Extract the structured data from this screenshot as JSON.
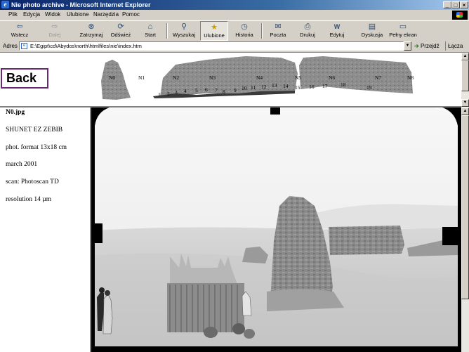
{
  "window": {
    "title": "Nie photo archive - Microsoft Internet Explorer",
    "controls": [
      "_",
      "□",
      "×"
    ]
  },
  "menu": [
    "Plik",
    "Edycja",
    "Widok",
    "Ulubione",
    "Narzędzia",
    "Pomoc"
  ],
  "toolbar": [
    {
      "label": "Wstecz",
      "icon": "back-arrow-icon",
      "glyph": "⇦",
      "enabled": true
    },
    {
      "label": "Dalej",
      "icon": "forward-arrow-icon",
      "glyph": "⇨",
      "enabled": false
    },
    {
      "label": "Zatrzymaj",
      "icon": "stop-icon",
      "glyph": "⊗",
      "enabled": true
    },
    {
      "label": "Odśwież",
      "icon": "refresh-icon",
      "glyph": "⟳",
      "enabled": true
    },
    {
      "label": "Start",
      "icon": "home-icon",
      "glyph": "⌂",
      "enabled": true
    },
    {
      "label": "Wyszukaj",
      "icon": "search-icon",
      "glyph": "⚲",
      "enabled": true
    },
    {
      "label": "Ulubione",
      "icon": "favorites-icon",
      "glyph": "★",
      "enabled": true
    },
    {
      "label": "Historia",
      "icon": "history-icon",
      "glyph": "◷",
      "enabled": true
    },
    {
      "label": "Poczta",
      "icon": "mail-icon",
      "glyph": "✉",
      "enabled": true
    },
    {
      "label": "Drukuj",
      "icon": "print-icon",
      "glyph": "⎙",
      "enabled": true
    },
    {
      "label": "Edytuj",
      "icon": "edit-icon",
      "glyph": "W",
      "enabled": true
    },
    {
      "label": "Dyskusja",
      "icon": "discuss-icon",
      "glyph": "▤",
      "enabled": true
    },
    {
      "label": "Pełny ekran",
      "icon": "fullscreen-icon",
      "glyph": "▭",
      "enabled": true
    }
  ],
  "address": {
    "label": "Adres",
    "value": "E:\\Egipt\\cd\\Abydos\\north\\htmlfiles\\nie\\index.htm",
    "go_label": "Przejdź",
    "links_label": "Łącza"
  },
  "back_label": "Back",
  "map": {
    "station_labels": [
      "N0",
      "N1",
      "N2",
      "N3",
      "N4",
      "N5",
      "N6",
      "N7",
      "N8"
    ],
    "point_numbers": [
      "1",
      "2",
      "3",
      "4",
      "5",
      "6",
      "7",
      "8",
      "9",
      "10",
      "11",
      "12",
      "13",
      "14",
      "15",
      "16",
      "17",
      "18",
      "19"
    ]
  },
  "info": {
    "filename": "N0.jpg",
    "site": "SHUNET EZ ZEBIB",
    "format": "phot. format 13x18 cm",
    "date": "march 2001",
    "scan": "scan: Photoscan TD",
    "resolution": "resolution 14 µm"
  },
  "colors": {
    "titlebar_start": "#0a246a",
    "titlebar_end": "#a6caf0",
    "back_border": "#6a2a72",
    "chrome": "#d4d0c8"
  }
}
